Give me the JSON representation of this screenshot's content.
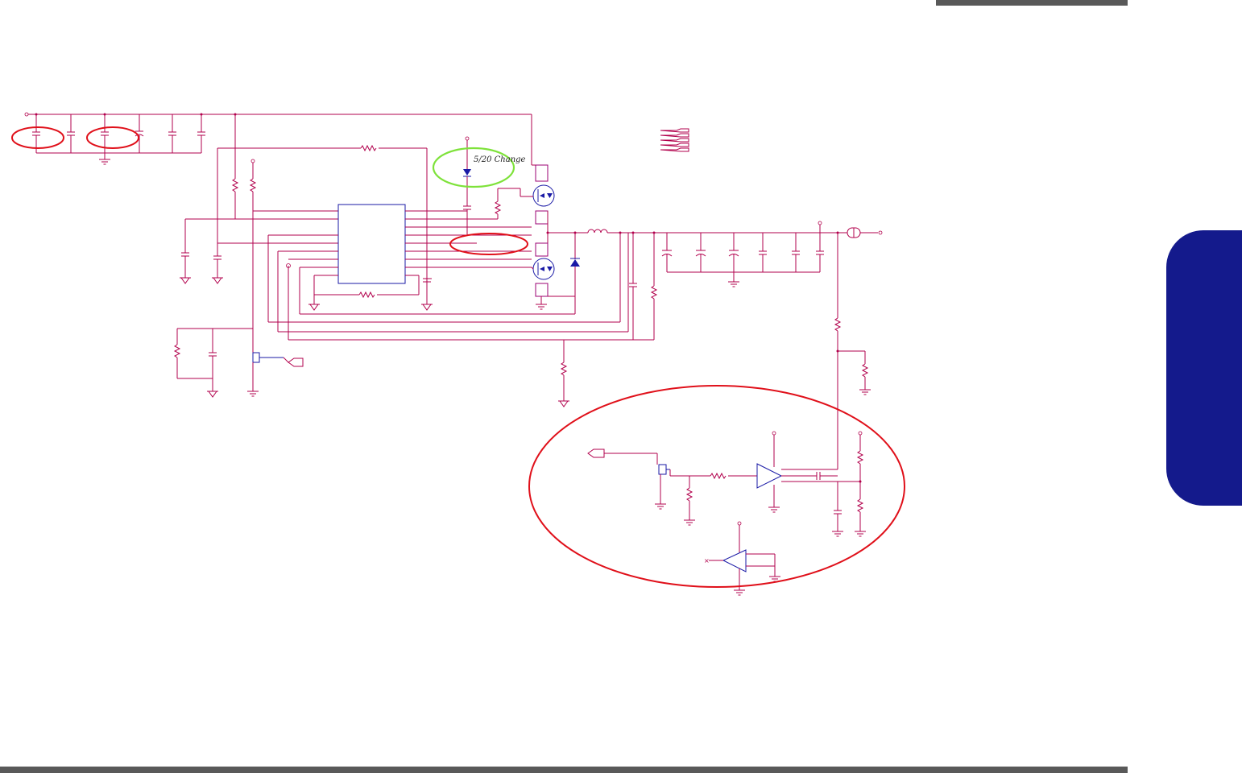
{
  "document": {
    "annotation_note": "5/20 Change"
  },
  "colors": {
    "wire": "#b2004c",
    "component_blue": "#1a1aa6",
    "highlight_red": "#e0101a",
    "highlight_green": "#7ee23a",
    "header_bar": "#595959",
    "side_tab": "#141a8c"
  }
}
